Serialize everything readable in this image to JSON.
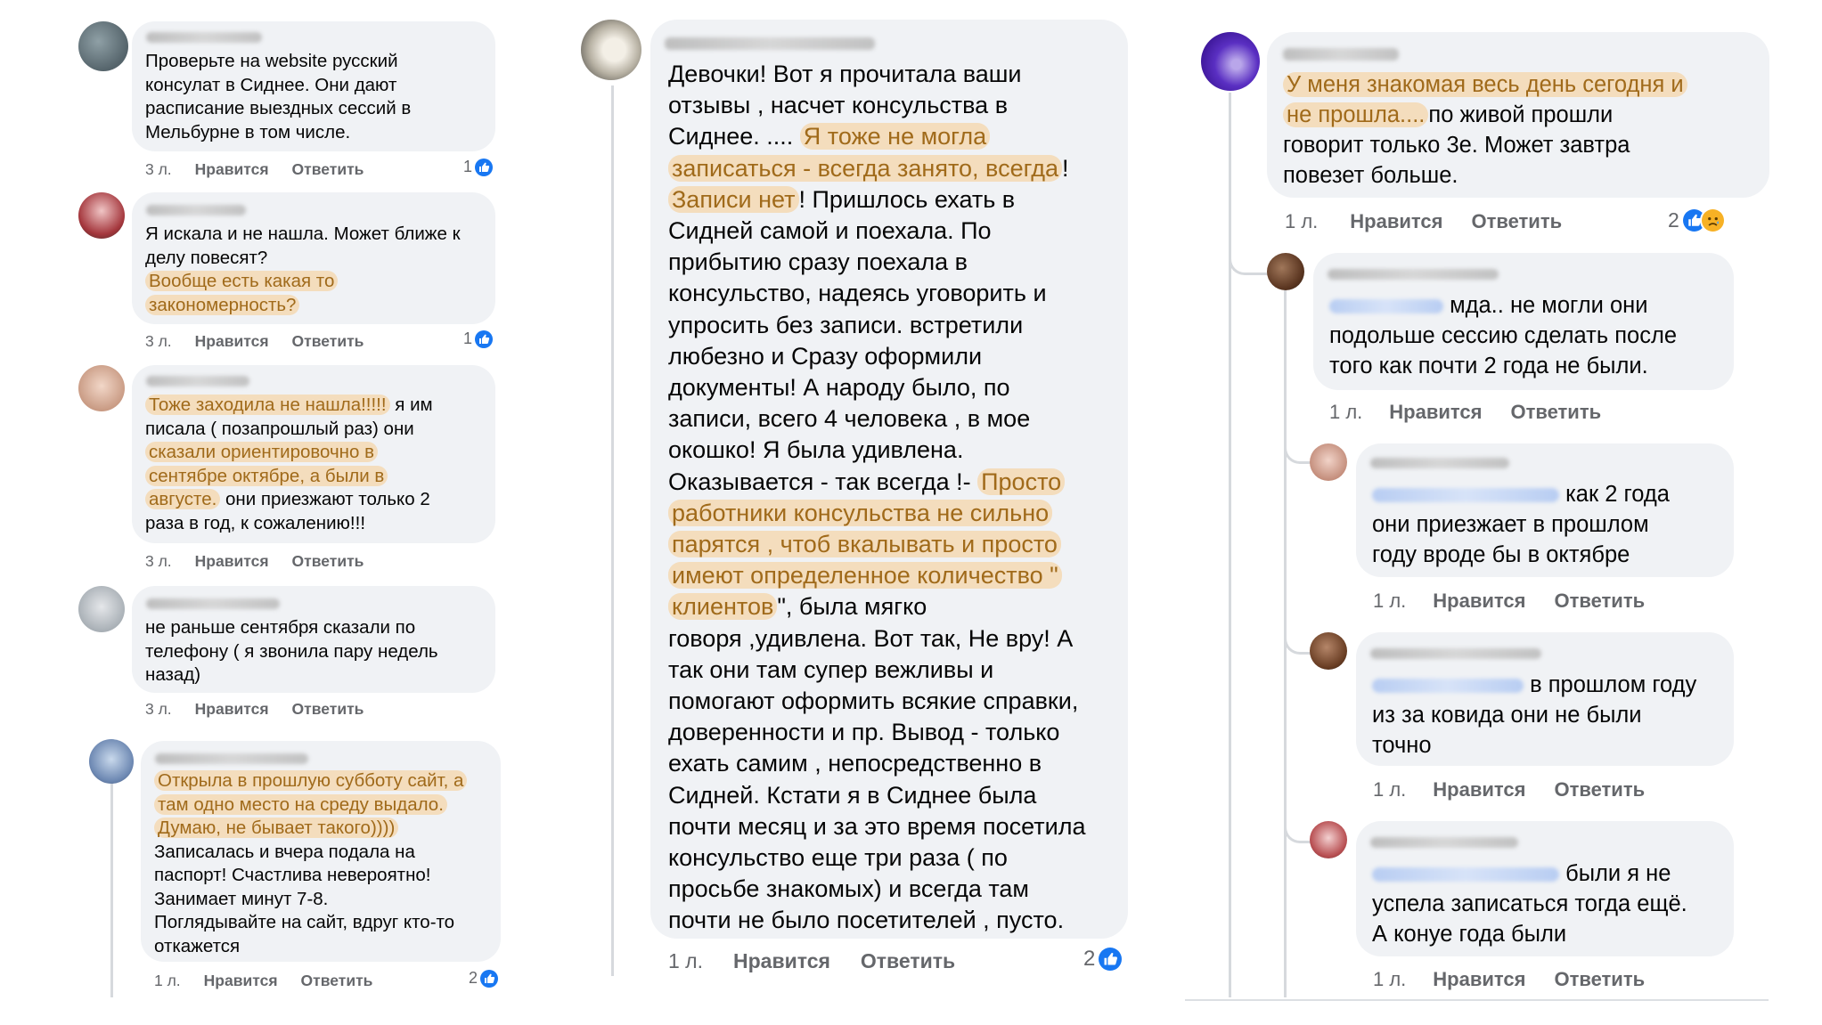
{
  "colors": {
    "highlight": "#f6d6aa",
    "like_blue": "#1877f2",
    "bubble_bg": "#f0f2f5",
    "meta_gray": "#65676b"
  },
  "left": {
    "comments": [
      {
        "text": [
          {
            "t": "Проверьте на website русский\nконсулат в Сиднее. Они дают\nрасписание выездных сессий в\nМельбурне в том числе."
          }
        ],
        "time": "3 л.",
        "like": "Нравится",
        "reply": "Ответить",
        "count": "1"
      },
      {
        "text": [
          {
            "t": "Я искала и не нашла. Может ближе к\nделу повесят?\n"
          },
          {
            "t": "Вообще есть какая то\nзакономерность?",
            "hl": true
          }
        ],
        "time": "3 л.",
        "like": "Нравится",
        "reply": "Ответить",
        "count": "1"
      },
      {
        "text": [
          {
            "t": "Тоже  заходила  не  нашла!!!!!",
            "hl": true
          },
          {
            "t": " я  им\nписала  (  позапрошлый  раз)  они\n"
          },
          {
            "t": "сказали  ориентировочно  в\nсентябре  октябре,  а  были  в\nавгусте.",
            "hl": true
          },
          {
            "t": "  они  приезжают  только  2\nраза  в  год,  к  сожалению!!!"
          }
        ],
        "time": "3 л.",
        "like": "Нравится",
        "reply": "Ответить",
        "count": ""
      },
      {
        "text": [
          {
            "t": "не раньше сентября  сказали по\nтелефону ( я звонила пару недель\nназад)"
          }
        ],
        "time": "3 л.",
        "like": "Нравится",
        "reply": "Ответить",
        "count": ""
      },
      {
        "text": [
          {
            "t": "Открыла в прошлую субботу сайт, а\nтам одно место на среду выдало.\nДумаю, не бывает такого))))",
            "hl": true
          },
          {
            "t": "\nЗаписалась и вчера подала на\nпаспорт! Счастлива невероятно!\nЗанимает минут 7-8.\nПоглядывайте на сайт, вдруг кто-то\nоткажется"
          }
        ],
        "time": "1 л.",
        "like": "Нравится",
        "reply": "Ответить",
        "count": "2"
      }
    ]
  },
  "middle": {
    "comment": {
      "text": [
        {
          "t": "Девочки! Вот я прочитала  ваши\nотзывы , насчет консульства в\nСиднее. .... "
        },
        {
          "t": "Я тоже не могла\nзаписаться - всегда занято, всегда",
          "hl": true
        },
        {
          "t": "!\n"
        },
        {
          "t": "Записи нет",
          "hl": true
        },
        {
          "t": "! Пришлось ехать в\nСидней самой и поехала. По\nприбытию сразу поехала в\nконсульство, надеясь уговорить и\nупросить без записи. встретили\nлюбезно и Сразу оформили\nдокументы! А народу было, по\nзаписи,  всего 4 человека , в мое\nокошко! Я была удивлена.\nОказывается - так всегда !- "
        },
        {
          "t": "Просто\nработники консульства не сильно\nпарятся , чтоб вкалывать и просто\nимеют определенное количество \"\nклиентов",
          "hl": true
        },
        {
          "t": "\", была мягко\nговоря ,удивлена.  Вот так, Не вру! А\nтак они там супер вежливы и\nпомогают оформить всякие справки,\nдоверенности и пр. Вывод - только\nехать самим  , непосредственно в\nСидней. Кстати я в Сиднее была\nпочти месяц и за это время посетила\nконсульство еще три раза ( по\nпросьбе знакомых) и всегда там\nпочти не было посетителей , пусто."
        }
      ],
      "time": "1 л.",
      "like": "Нравится",
      "reply": "Ответить",
      "count": "2"
    }
  },
  "right": {
    "main": {
      "text": [
        {
          "t": "У меня знакомая весь день сегодня и\nне прошла....",
          "hl": true
        },
        {
          "t": "по живой прошли\nговорит только 3е. Может завтра\nповезет больше."
        }
      ],
      "time": "1 л.",
      "like": "Нравится",
      "reply": "Ответить",
      "count": "2"
    },
    "replies": [
      {
        "text": "мда.. не могли они\nподольше сессию сделать после\nтого как почти 2 года не были.",
        "time": "1 л.",
        "like": "Нравится",
        "reply": "Ответить"
      },
      {
        "text": "как 2 года\nони приезжает в прошлом\nгоду вроде бы в октябре",
        "time": "1 л.",
        "like": "Нравится",
        "reply": "Ответить"
      },
      {
        "text": "в прошлом году\nиз за ковида они не были\nточно",
        "time": "1 л.",
        "like": "Нравится",
        "reply": "Ответить"
      },
      {
        "text": "были я не\nуспела записаться тогда ещё.\nА конуе года были",
        "time": "1 л.",
        "like": "Нравится",
        "reply": "Ответить"
      }
    ]
  }
}
